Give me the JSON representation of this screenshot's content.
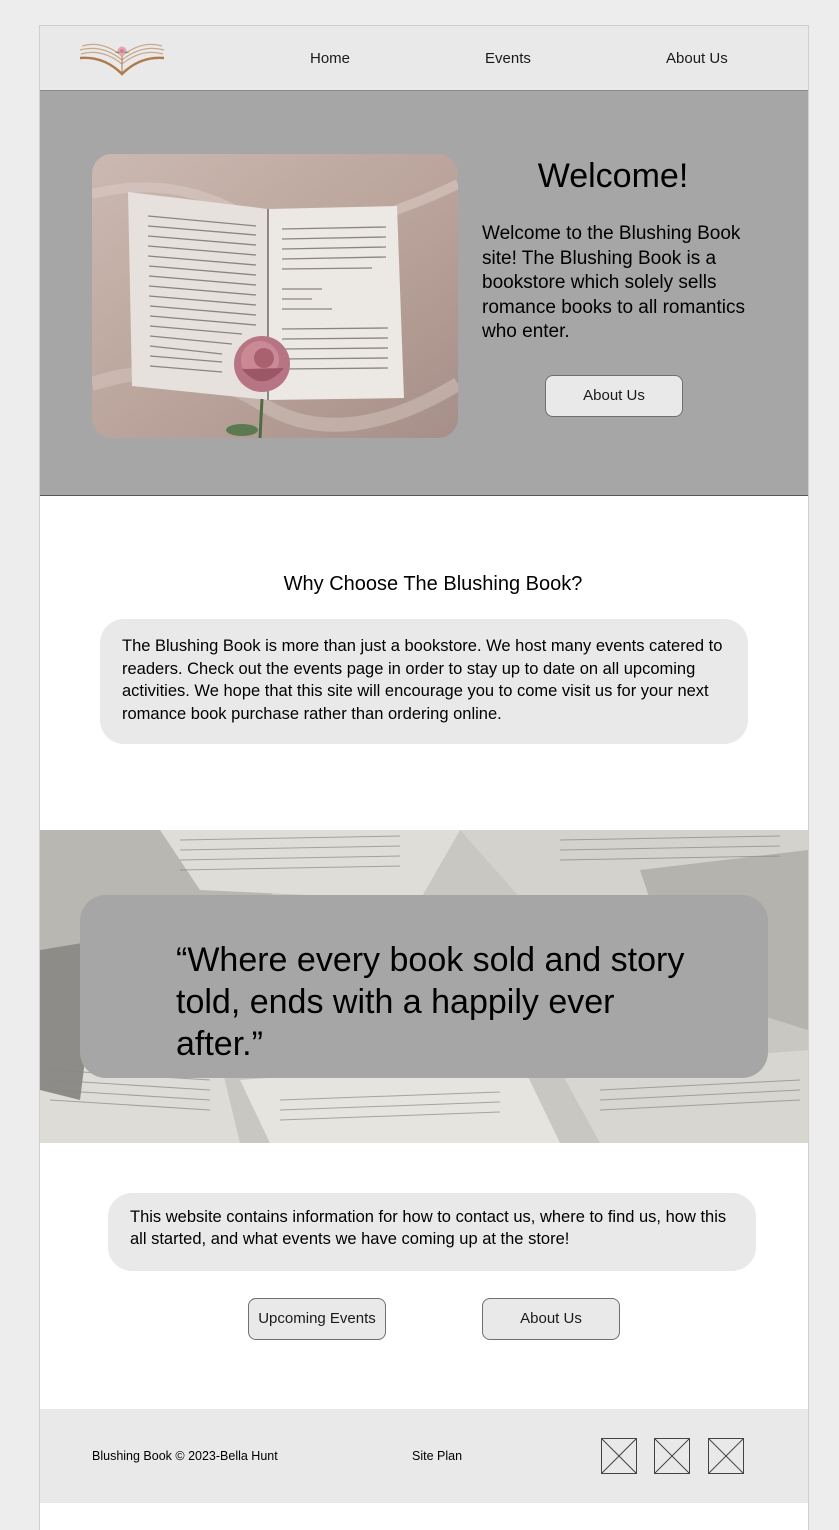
{
  "nav": {
    "logo": "blushing-book-logo-icon",
    "items": [
      "Home",
      "Events",
      "About Us"
    ]
  },
  "hero": {
    "title": "Welcome!",
    "text": "Welcome to the Blushing Book site! The Blushing Book is a bookstore which solely sells romance books to all romantics who enter.",
    "button": "About Us",
    "image": "open-book-with-rose-photo"
  },
  "why": {
    "title": "Why Choose The Blushing Book?",
    "text": "The Blushing Book is more than just a bookstore. We host many events catered to readers. Check out the events page in order to stay up to date on all upcoming activities. We hope that this site will encourage you to come visit us for your next romance book purchase rather than ordering online."
  },
  "banner": {
    "image": "scattered-open-books-photo",
    "quote": "“Where every book sold and story told, ends with a happily ever after.”"
  },
  "info": {
    "text": "This website contains information for how to contact us, where to find us, how this all started, and what events we have coming up at the store!",
    "buttons": [
      "Upcoming Events",
      "About Us"
    ]
  },
  "footer": {
    "copyright": "Blushing Book © 2023-Bella Hunt",
    "site_plan": "Site Plan",
    "social_icons": [
      "social-placeholder-icon",
      "social-placeholder-icon",
      "social-placeholder-icon"
    ]
  },
  "colors": {
    "page_bg": "#ededed",
    "panel_gray": "#e9e9e9",
    "hero_gray": "#a6a6a6",
    "logo_brown": "#b07a4a",
    "logo_pink": "#e7a3b4"
  }
}
